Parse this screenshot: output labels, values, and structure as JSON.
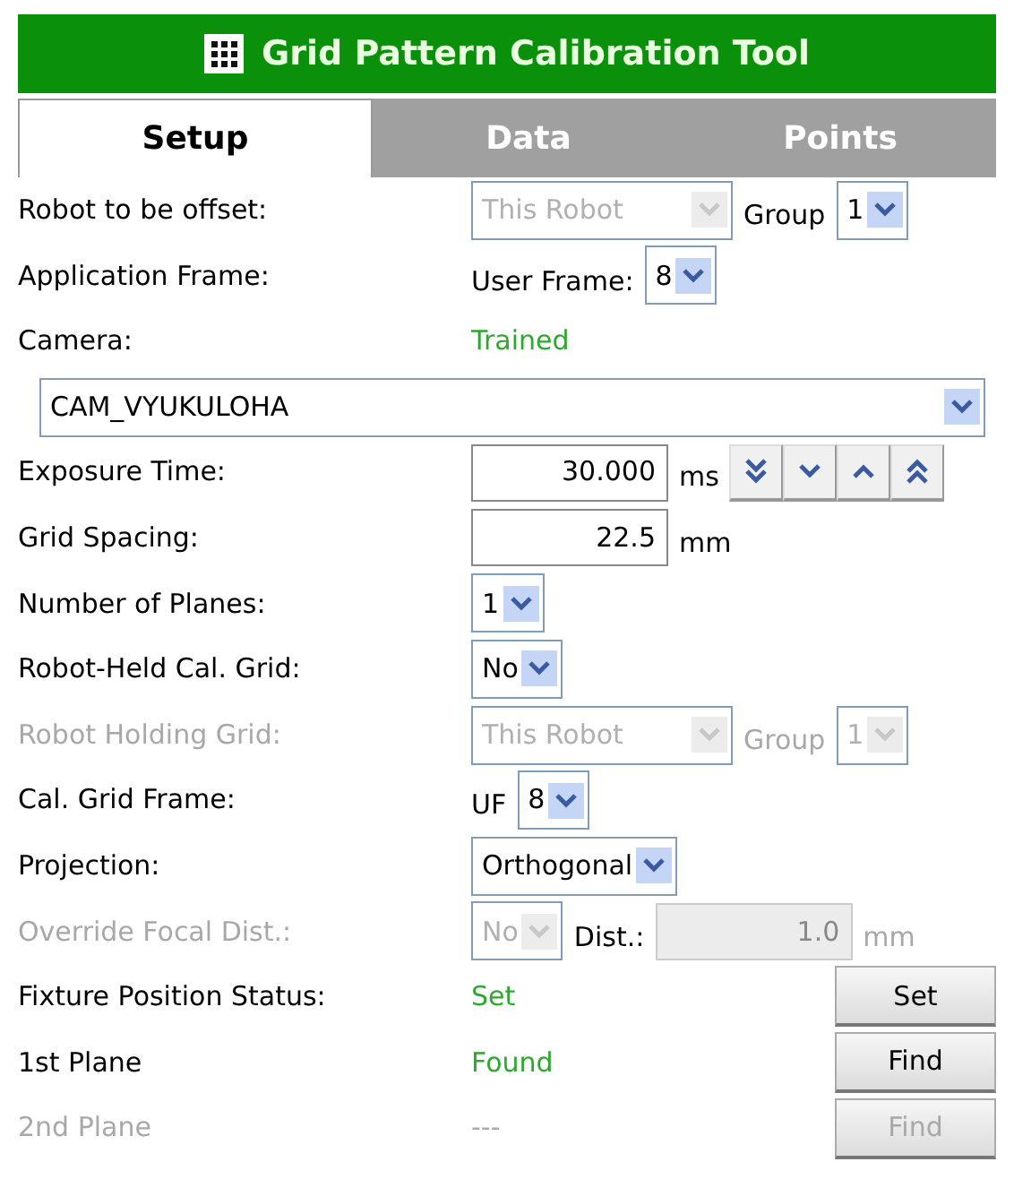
{
  "header": {
    "title": "Grid Pattern Calibration Tool"
  },
  "tabs": [
    {
      "label": "Setup",
      "selected": true
    },
    {
      "label": "Data",
      "selected": false
    },
    {
      "label": "Points",
      "selected": false
    }
  ],
  "rows": [
    {
      "label": "Robot to be offset:",
      "disabled": false,
      "controls": [
        {
          "kind": "wide_select",
          "value": "This Robot",
          "disabled": true
        },
        {
          "kind": "text",
          "value": "Group",
          "disabled": false
        },
        {
          "kind": "select",
          "value": "1",
          "disabled": false
        }
      ]
    },
    {
      "label": "Application Frame:",
      "disabled": false,
      "controls": [
        {
          "kind": "text",
          "value": "User Frame:",
          "disabled": false
        },
        {
          "kind": "select",
          "value": "8",
          "disabled": false
        }
      ]
    },
    {
      "label": "Camera:",
      "disabled": false,
      "controls": [
        {
          "kind": "status",
          "value": "Trained",
          "disabled": false
        }
      ]
    },
    {
      "kind": "wide",
      "controls": [
        {
          "kind": "full_select",
          "value": "CAM_VYUKULOHA",
          "disabled": false
        }
      ]
    },
    {
      "label": "Exposure Time:",
      "disabled": false,
      "controls": [
        {
          "kind": "input",
          "value": "30.000",
          "disabled": false
        },
        {
          "kind": "text",
          "value": "ms",
          "disabled": false
        },
        {
          "kind": "stepper"
        }
      ]
    },
    {
      "label": "Grid Spacing:",
      "disabled": false,
      "controls": [
        {
          "kind": "input",
          "value": "22.5",
          "disabled": false
        },
        {
          "kind": "text",
          "value": "mm",
          "disabled": false
        }
      ]
    },
    {
      "label": "Number of Planes:",
      "disabled": false,
      "controls": [
        {
          "kind": "select",
          "value": "1",
          "disabled": false
        }
      ]
    },
    {
      "label": "Robot-Held Cal. Grid:",
      "disabled": false,
      "controls": [
        {
          "kind": "select",
          "value": "No",
          "disabled": false
        }
      ]
    },
    {
      "label": "Robot Holding Grid:",
      "disabled": true,
      "controls": [
        {
          "kind": "wide_select",
          "value": "This Robot",
          "disabled": true
        },
        {
          "kind": "text",
          "value": "Group",
          "disabled": true
        },
        {
          "kind": "select",
          "value": "1",
          "disabled": true
        }
      ]
    },
    {
      "label": "Cal. Grid Frame:",
      "disabled": false,
      "controls": [
        {
          "kind": "text",
          "value": "UF",
          "disabled": false
        },
        {
          "kind": "select",
          "value": "8",
          "disabled": false
        }
      ]
    },
    {
      "label": "Projection:",
      "disabled": false,
      "controls": [
        {
          "kind": "select",
          "value": "Orthogonal",
          "disabled": false
        }
      ]
    },
    {
      "label": "Override Focal Dist.:",
      "disabled": true,
      "controls": [
        {
          "kind": "select",
          "value": "No",
          "disabled": true
        },
        {
          "kind": "text",
          "value": "Dist.:",
          "disabled": false
        },
        {
          "kind": "input",
          "value": "1.0",
          "disabled": true
        },
        {
          "kind": "text",
          "value": "mm",
          "disabled": true
        }
      ]
    },
    {
      "label": "Fixture Position Status:",
      "disabled": false,
      "controls": [
        {
          "kind": "status",
          "value": "Set",
          "disabled": false
        },
        {
          "kind": "button",
          "value": "Set",
          "disabled": false
        }
      ]
    },
    {
      "label": "1st Plane",
      "disabled": false,
      "controls": [
        {
          "kind": "status",
          "value": "Found",
          "disabled": false
        },
        {
          "kind": "button",
          "value": "Find",
          "disabled": false
        }
      ]
    },
    {
      "label": "2nd Plane",
      "disabled": true,
      "controls": [
        {
          "kind": "status",
          "value": "---",
          "disabled": true
        },
        {
          "kind": "button",
          "value": "Find",
          "disabled": true
        }
      ]
    }
  ]
}
